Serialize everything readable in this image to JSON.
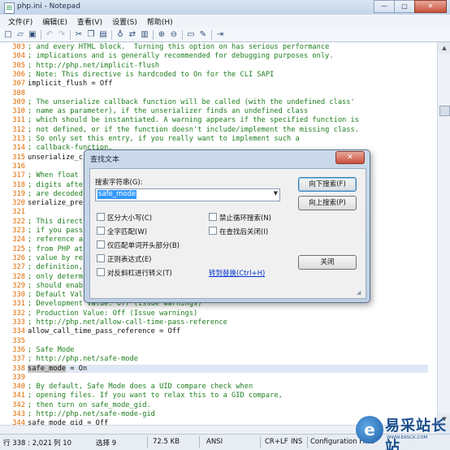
{
  "window": {
    "title": "php.ini - Notepad",
    "controls": [
      "—",
      "□",
      "✕"
    ]
  },
  "menu": [
    "文件(F)",
    "编辑(E)",
    "查看(V)",
    "设置(S)",
    "帮助(H)"
  ],
  "toolbar": {
    "icons": [
      {
        "name": "new-file-icon",
        "glyph": "□"
      },
      {
        "name": "open-file-icon",
        "glyph": "▱"
      },
      {
        "name": "save-icon",
        "glyph": "▣"
      },
      {
        "name": "sep"
      },
      {
        "name": "undo-icon",
        "glyph": "↶",
        "disabled": true
      },
      {
        "name": "redo-icon",
        "glyph": "↷",
        "disabled": true
      },
      {
        "name": "sep"
      },
      {
        "name": "cut-icon",
        "glyph": "✂"
      },
      {
        "name": "copy-icon",
        "glyph": "❐"
      },
      {
        "name": "paste-icon",
        "glyph": "▤"
      },
      {
        "name": "sep"
      },
      {
        "name": "find-icon",
        "glyph": "♁"
      },
      {
        "name": "replace-icon",
        "glyph": "⇄"
      },
      {
        "name": "goto-icon",
        "glyph": "▥"
      },
      {
        "name": "sep"
      },
      {
        "name": "zoom-in-icon",
        "glyph": "⊕"
      },
      {
        "name": "zoom-out-icon",
        "glyph": "⊖"
      },
      {
        "name": "sep"
      },
      {
        "name": "word-wrap-icon",
        "glyph": "▭"
      },
      {
        "name": "edit-icon",
        "glyph": "✎"
      },
      {
        "name": "sep"
      },
      {
        "name": "launch-icon",
        "glyph": "⇥"
      }
    ]
  },
  "editor": {
    "lines": [
      {
        "n": "303",
        "text": "; and every HTML block.  Turning this option on has serious performance",
        "type": "comment"
      },
      {
        "n": "304",
        "text": "; implications and is generally recommended for debugging purposes only.",
        "type": "comment"
      },
      {
        "n": "305",
        "text": "; http://php.net/implicit-flush",
        "type": "comment"
      },
      {
        "n": "306",
        "text": "; Note: This directive is hardcoded to On for the CLI SAPI",
        "type": "comment"
      },
      {
        "n": "307",
        "text": "implicit_flush = Off",
        "type": "code"
      },
      {
        "n": "308",
        "text": "",
        "type": "code"
      },
      {
        "n": "309",
        "text": "; The unserialize callback function will be called (with the undefined class'",
        "type": "comment"
      },
      {
        "n": "310",
        "text": "; name as parameter), if the unserializer finds an undefined class",
        "type": "comment"
      },
      {
        "n": "311",
        "text": "; which should be instantiated. A warning appears if the specified function is",
        "type": "comment"
      },
      {
        "n": "312",
        "text": "; not defined, or if the function doesn't include/implement the missing class.",
        "type": "comment"
      },
      {
        "n": "313",
        "text": "; So only set this entry, if you really want to implement such a",
        "type": "comment"
      },
      {
        "n": "314",
        "text": "; callback-function.",
        "type": "comment"
      },
      {
        "n": "315",
        "text": "unserialize_c",
        "type": "code"
      },
      {
        "n": "316",
        "text": "",
        "type": "code"
      },
      {
        "n": "317",
        "text": "; When float",
        "type": "comment"
      },
      {
        "n": "318",
        "text": "; digits afte",
        "type": "comment"
      },
      {
        "n": "319",
        "text": "; are decoded",
        "type": "comment"
      },
      {
        "n": "320",
        "text": "serialize_pre",
        "type": "code"
      },
      {
        "n": "321",
        "text": "",
        "type": "code"
      },
      {
        "n": "322",
        "text": "; This direct                                                              e",
        "type": "comment"
      },
      {
        "n": "323",
        "text": "; if you pass                                                               s",
        "type": "comment"
      },
      {
        "n": "324",
        "text": "; reference a                                                               d",
        "type": "comment"
      },
      {
        "n": "325",
        "text": "; from PHP at                                                               a",
        "type": "comment"
      },
      {
        "n": "326",
        "text": "; value by re                                                               ons",
        "type": "comment"
      },
      {
        "n": "327",
        "text": "; definition,                                                               l",
        "type": "comment"
      },
      {
        "n": "328",
        "text": "; only determ",
        "type": "comment"
      },
      {
        "n": "329",
        "text": "; should enab",
        "type": "comment"
      },
      {
        "n": "330",
        "text": "; Default Val",
        "type": "comment"
      },
      {
        "n": "331",
        "text": "; Development Value: Off (Issue warnings)",
        "type": "comment"
      },
      {
        "n": "332",
        "text": "; Production Value: Off (Issue warnings)",
        "type": "comment"
      },
      {
        "n": "333",
        "text": "; http://php.net/allow-call-time-pass-reference",
        "type": "comment"
      },
      {
        "n": "334",
        "text": "allow_call_time_pass_reference = Off",
        "type": "code"
      },
      {
        "n": "335",
        "text": "",
        "type": "code"
      },
      {
        "n": "336",
        "text": "; Safe Mode",
        "type": "comment"
      },
      {
        "n": "337",
        "text": "; http://php.net/safe-mode",
        "type": "comment"
      },
      {
        "n": "338",
        "text": "safe_mode = On",
        "type": "code",
        "current": true
      },
      {
        "n": "339",
        "text": "",
        "type": "code"
      },
      {
        "n": "340",
        "text": "; By default, Safe Mode does a UID compare check when",
        "type": "comment"
      },
      {
        "n": "341",
        "text": "; opening files. If you want to relax this to a GID compare,",
        "type": "comment"
      },
      {
        "n": "342",
        "text": "; then turn on safe_mode_gid.",
        "type": "comment"
      },
      {
        "n": "343",
        "text": "; http://php.net/safe-mode-gid",
        "type": "comment"
      },
      {
        "n": "344",
        "text": "safe_mode_gid = Off",
        "type": "code"
      }
    ],
    "selected_word": "safe_mode"
  },
  "find_dialog": {
    "title": "查找文本",
    "close_glyph": "✕",
    "search_label": "搜索字符串(G):",
    "search_value": "safe_mode",
    "dropdown_glyph": "▼",
    "find_next": "向下搜索(F)",
    "find_prev": "向上搜索(P)",
    "close": "关闭",
    "options_left": [
      "区分大小写(C)",
      "全字匹配(W)",
      "仅匹配单词开头部分(B)",
      "正则表达式(E)",
      "对反斜杠进行转义(T)"
    ],
    "options_right": [
      "禁止循环搜索(N)",
      "在查找后关闭(I)"
    ],
    "replace_link": "转到替换(Ctrl+H)"
  },
  "status": {
    "position": "行 338 : 2,021",
    "column": "列 10",
    "selection": "选择 9",
    "size": "72.5 KB",
    "encoding": "ANSI",
    "eol": "CR+LF",
    "mode": "INS",
    "scheme": "Configuration Files"
  },
  "watermark": {
    "logo": "e",
    "name": "易采站长站",
    "sub": "WWW.EASCK.COM"
  }
}
